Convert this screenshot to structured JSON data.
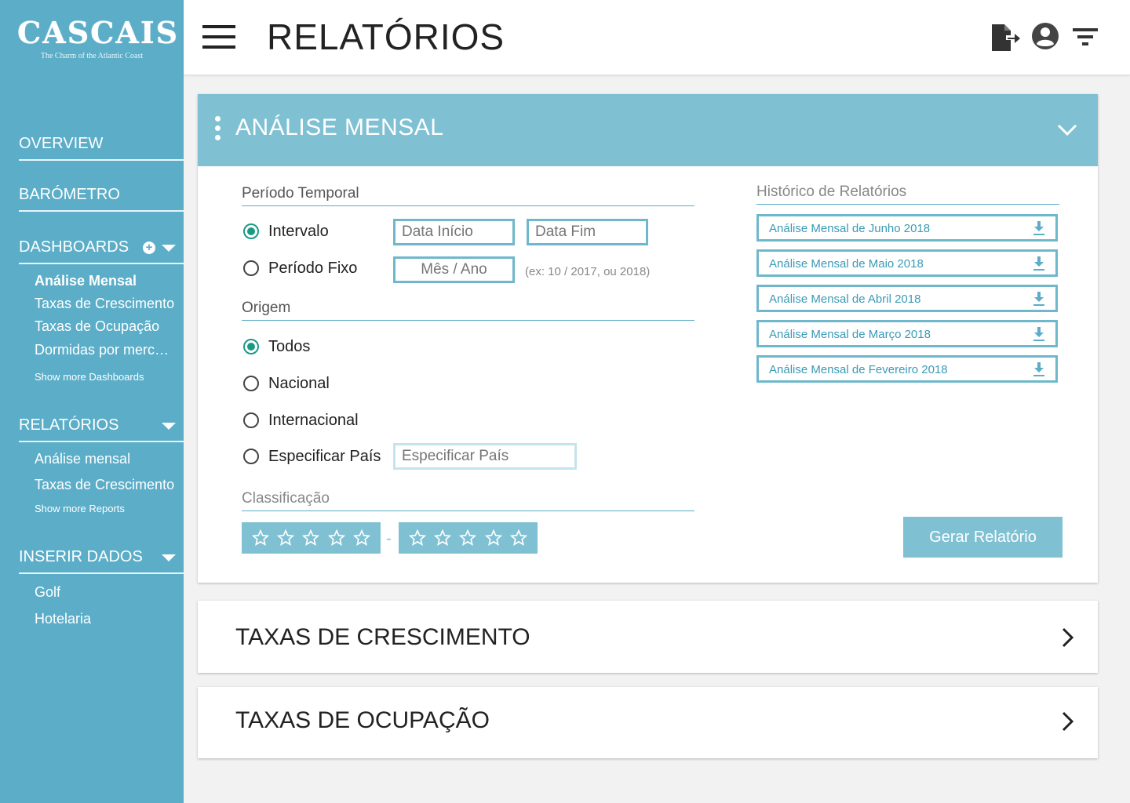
{
  "brand": {
    "name": "CASCAIS",
    "tagline": "The Charm of the Atlantic Coast"
  },
  "sidebar": {
    "overview": "OVERVIEW",
    "barometro": "BARÓMETRO",
    "dashboards": {
      "label": "DASHBOARDS",
      "items": [
        "Análise Mensal",
        "Taxas de Crescimento",
        "Taxas de Ocupação",
        "Dormidas por mercado"
      ],
      "more": "Show more Dashboards"
    },
    "relatorios": {
      "label": "RELATÓRIOS",
      "items": [
        "Análise mensal",
        "Taxas de Crescimento"
      ],
      "more": "Show more Reports"
    },
    "inserir": {
      "label": "INSERIR DADOS",
      "items": [
        "Golf",
        "Hotelaria"
      ]
    }
  },
  "header": {
    "title": "RELATÓRIOS"
  },
  "analise": {
    "title": "ANÁLISE MENSAL",
    "periodo": {
      "label": "Período Temporal",
      "intervalo": "Intervalo",
      "fixo": "Período Fixo",
      "data_inicio_placeholder": "Data Início",
      "data_fim_placeholder": "Data Fim",
      "mes_ano_placeholder": "Mês / Ano",
      "hint": "(ex: 10 / 2017, ou 2018)"
    },
    "origem": {
      "label": "Origem",
      "todos": "Todos",
      "nacional": "Nacional",
      "internacional": "Internacional",
      "especificar": "Especificar País",
      "pais_placeholder": "Especificar País"
    },
    "classificacao": {
      "label": "Classificação",
      "separator": "-"
    },
    "historico": {
      "label": "Histórico de Relatórios",
      "items": [
        "Análise Mensal de Junho 2018",
        "Análise Mensal de Maio 2018",
        "Análise Mensal de Abril 2018",
        "Análise Mensal de Março 2018",
        "Análise Mensal de Fevereiro 2018"
      ]
    },
    "gerar": "Gerar Relatório"
  },
  "cards": {
    "crescimento": "TAXAS DE CRESCIMENTO",
    "ocupacao": "TAXAS DE OCUPAÇÃO"
  },
  "colors": {
    "sidebar": "#5badc8",
    "accent": "#7fc1d3",
    "radio": "#1a9a86"
  }
}
